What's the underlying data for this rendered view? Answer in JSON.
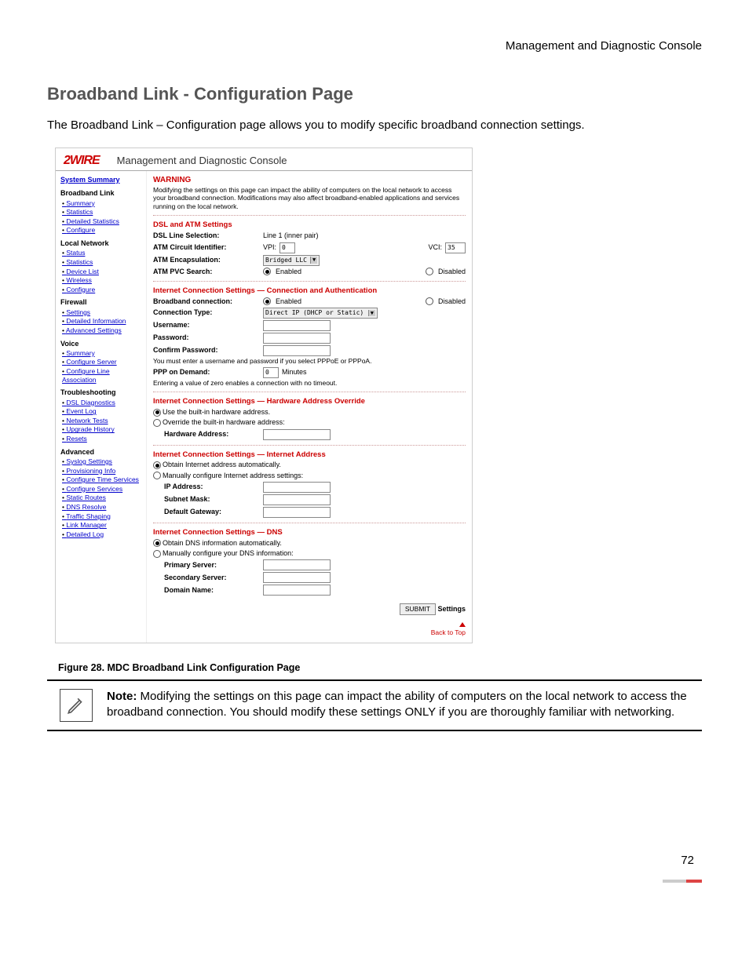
{
  "header_right": "Management and Diagnostic Console",
  "section_title": "Broadband Link - Configuration Page",
  "intro": "The Broadband Link – Configuration page allows you to modify specific broadband connection settings.",
  "ss": {
    "logo": "2WIRE",
    "title": "Management and Diagnostic Console",
    "nav": {
      "system_summary": "System Summary",
      "broadband_link": "Broadband Link",
      "bl_summary": "Summary",
      "bl_statistics": "Statistics",
      "bl_detailed_stats": "Detailed Statistics",
      "bl_configure": "Configure",
      "local_network": "Local Network",
      "ln_status": "Status",
      "ln_statistics": "Statistics",
      "ln_device_list": "Device List",
      "ln_wireless": "Wireless",
      "ln_configure": "Configure",
      "firewall": "Firewall",
      "fw_settings": "Settings",
      "fw_detailed": "Detailed Information",
      "fw_advanced": "Advanced Settings",
      "voice": "Voice",
      "v_summary": "Summary",
      "v_configure_server": "Configure Server",
      "v_configure_line": "Configure Line Association",
      "troubleshooting": "Troubleshooting",
      "t_dsl": "DSL Diagnostics",
      "t_event": "Event Log",
      "t_network": "Network Tests",
      "t_upgrade": "Upgrade History",
      "t_resets": "Resets",
      "advanced": "Advanced",
      "a_syslog": "Syslog Settings",
      "a_prov": "Provisioning Info",
      "a_time": "Configure Time Services",
      "a_services": "Configure Services",
      "a_static": "Static Routes",
      "a_dns": "DNS Resolve",
      "a_traffic": "Traffic Shaping",
      "a_link": "Link Manager",
      "a_detailed": "Detailed Log"
    },
    "warn_title": "WARNING",
    "warn_text": "Modifying the settings on this page can impact the ability of computers on the local network to access your broadband connection. Modifications may also affect broadband-enabled applications and services running on the local network.",
    "dsl": {
      "title": "DSL and ATM Settings",
      "line_sel_lbl": "DSL Line Selection:",
      "line_sel_val": "Line 1 (inner pair)",
      "circuit_lbl": "ATM Circuit Identifier:",
      "vpi_lbl": "VPI:",
      "vpi_val": "0",
      "vci_lbl": "VCI:",
      "vci_val": "35",
      "encap_lbl": "ATM Encapsulation:",
      "encap_val": "Bridged LLC",
      "pvc_lbl": "ATM PVC Search:",
      "enabled": "Enabled",
      "disabled": "Disabled"
    },
    "conn": {
      "title": "Internet Connection Settings — Connection and Authentication",
      "bb_lbl": "Broadband connection:",
      "enabled": "Enabled",
      "disabled": "Disabled",
      "type_lbl": "Connection Type:",
      "type_val": "Direct IP (DHCP or Static)",
      "user_lbl": "Username:",
      "pass_lbl": "Password:",
      "confirm_lbl": "Confirm Password:",
      "hint1": "You must enter a username and password if you select PPPoE or PPPoA.",
      "ppp_lbl": "PPP on Demand:",
      "ppp_val": "0",
      "ppp_unit": "Minutes",
      "hint2": "Entering a value of zero enables a connection with no timeout."
    },
    "hw": {
      "title": "Internet Connection Settings — Hardware Address Override",
      "opt1": "Use the built-in hardware address.",
      "opt2": "Override the built-in hardware address:",
      "addr_lbl": "Hardware Address:"
    },
    "ip": {
      "title": "Internet Connection Settings — Internet Address",
      "opt1": "Obtain Internet address automatically.",
      "opt2": "Manually configure Internet address settings:",
      "ip_lbl": "IP Address:",
      "mask_lbl": "Subnet Mask:",
      "gw_lbl": "Default Gateway:"
    },
    "dns": {
      "title": "Internet Connection Settings — DNS",
      "opt1": "Obtain DNS information automatically.",
      "opt2": "Manually configure your DNS information:",
      "primary_lbl": "Primary Server:",
      "secondary_lbl": "Secondary Server:",
      "domain_lbl": "Domain Name:"
    },
    "submit_btn": "SUBMIT",
    "submit_lbl": "Settings",
    "back_to_top": "Back to Top"
  },
  "figure_caption": "Figure 28. MDC Broadband Link Configuration Page",
  "note_label": "Note:",
  "note_text": "Modifying the settings on this page can impact the ability of computers on the local network to access the broadband connection. You should modify these settings ONLY if you are thoroughly familiar with networking.",
  "page_number": "72"
}
